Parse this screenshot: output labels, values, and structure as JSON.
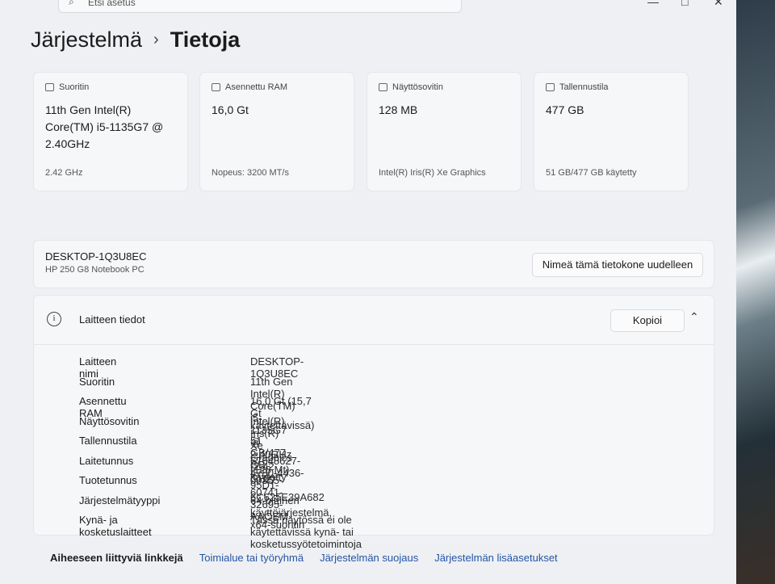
{
  "window": {
    "search_placeholder": "Etsi asetus",
    "minimize": "—",
    "maximize": "□",
    "close": "✕"
  },
  "breadcrumb": {
    "parent": "Järjestelmä",
    "current": "Tietoja"
  },
  "cards": [
    {
      "icon": "processor-icon",
      "label": "Suoritin",
      "value": "11th Gen Intel(R) Core(TM) i5-1135G7 @ 2.40GHz",
      "footer": "2.42 GHz"
    },
    {
      "icon": "ram-icon",
      "label": "Asennettu RAM",
      "value": "16,0 Gt",
      "footer": "Nopeus: 3200 MT/s"
    },
    {
      "icon": "display-adapter-icon",
      "label": "Näyttösovitin",
      "value": "128 MB",
      "footer": "Intel(R) Iris(R) Xe Graphics"
    },
    {
      "icon": "storage-icon",
      "label": "Tallennustila",
      "value": "477 GB",
      "footer": "51 GB/477 GB käytetty"
    }
  ],
  "pc": {
    "name": "DESKTOP-1Q3U8EC",
    "model": "HP 250 G8 Notebook PC",
    "rename_button": "Nimeä tämä tietokone uudelleen"
  },
  "device_specs": {
    "title": "Laitteen tiedot",
    "copy_button": "Kopioi",
    "rows": [
      {
        "key": "Laitteen nimi",
        "value": "DESKTOP-1Q3U8EC"
      },
      {
        "key": "Suoritin",
        "value": "11th Gen Intel(R) Core(TM) i5-1135G7 @ 2.40GHz (2.42 GHz)"
      },
      {
        "key": "Asennettu RAM",
        "value": "16,0 Gt (15,7 Gt käytettävissä)"
      },
      {
        "key": "Näyttösovitin",
        "value": "Intel(R) Iris(R) Xe Graphics (128 Mt)"
      },
      {
        "key": "Tallennustila",
        "value": "51 GB/477 GB käytetty"
      },
      {
        "key": "Laitetunnus",
        "value": "67648627-4780-4436-95D1-6C625E39A682"
      },
      {
        "key": "Tuotetunnus",
        "value": "00355-60741-32695-AAOEM"
      },
      {
        "key": "Järjestelmätyyppi",
        "value": "64-bittinen käyttöjärjestelmä, x64-suoritin"
      },
      {
        "key": "Kynä- ja kosketuslaitteet",
        "value": "Tässä näytössä ei ole käytettävissä kynä- tai kosketussyötetoimintoja"
      }
    ]
  },
  "related": {
    "label": "Aiheeseen liittyviä linkkejä",
    "links": [
      "Toimialue tai työryhmä",
      "Järjestelmän suojaus",
      "Järjestelmän lisäasetukset"
    ]
  }
}
